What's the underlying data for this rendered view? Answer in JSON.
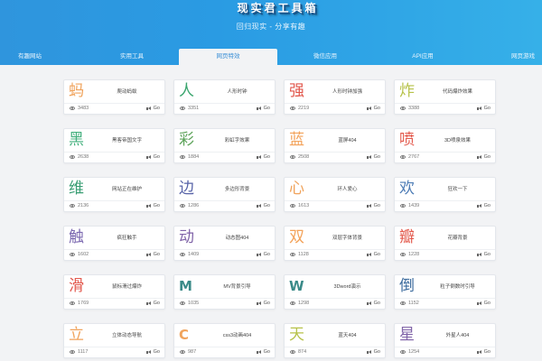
{
  "header": {
    "logo_chars": [
      "现",
      "实",
      "君",
      "工",
      "具",
      "箱"
    ],
    "subtitle": "回归现实 - 分享有趣",
    "accent_color": "#2f95dd"
  },
  "nav": {
    "tabs": [
      {
        "label": "有趣网站",
        "active": false
      },
      {
        "label": "实用工具",
        "active": false
      },
      {
        "label": "网页特效",
        "active": true
      },
      {
        "label": "微信应用",
        "active": false
      },
      {
        "label": "API应用",
        "active": false
      },
      {
        "label": "网页游戏",
        "active": false
      }
    ]
  },
  "cards": [
    {
      "char": "蚂",
      "color": "#f0a35c",
      "name": "爬动蚂蚁",
      "views": "3483",
      "go": "Go"
    },
    {
      "char": "人",
      "color": "#3aa56e",
      "name": "人形时钟",
      "views": "3351",
      "go": "Go"
    },
    {
      "char": "强",
      "color": "#e2574c",
      "name": "人形时钟加强",
      "views": "2219",
      "go": "Go"
    },
    {
      "char": "炸",
      "color": "#b7c24a",
      "name": "代码爆炸效果",
      "views": "3388",
      "go": "Go"
    },
    {
      "char": "黑",
      "color": "#45b07e",
      "name": "黑客帝国文字",
      "views": "2638",
      "go": "Go"
    },
    {
      "char": "彩",
      "color": "#5ea45b",
      "name": "彩虹字效果",
      "views": "1884",
      "go": "Go"
    },
    {
      "char": "蓝",
      "color": "#f3a35b",
      "name": "蓝屏404",
      "views": "2508",
      "go": "Go"
    },
    {
      "char": "喷",
      "color": "#e35a4d",
      "name": "3D喷泉效果",
      "views": "2767",
      "go": "Go"
    },
    {
      "char": "维",
      "color": "#3a9e74",
      "name": "网站正在维护",
      "views": "2136",
      "go": "Go"
    },
    {
      "char": "边",
      "color": "#5864a8",
      "name": "多边形背景",
      "views": "1286",
      "go": "Go"
    },
    {
      "char": "心",
      "color": "#f0a35c",
      "name": "环人爱心",
      "views": "1613",
      "go": "Go"
    },
    {
      "char": "欢",
      "color": "#4c7bb5",
      "name": "狂欢一下",
      "views": "1439",
      "go": "Go"
    },
    {
      "char": "触",
      "color": "#7b68b0",
      "name": "疯狂触手",
      "views": "1602",
      "go": "Go"
    },
    {
      "char": "动",
      "color": "#8064a8",
      "name": "动态图404",
      "views": "1409",
      "go": "Go"
    },
    {
      "char": "双",
      "color": "#f3a35b",
      "name": "双层字体背景",
      "views": "1128",
      "go": "Go"
    },
    {
      "char": "瓣",
      "color": "#e35a4d",
      "name": "花瓣背景",
      "views": "1228",
      "go": "Go"
    },
    {
      "char": "滑",
      "color": "#e2574c",
      "name": "鼠标滑过爆炸",
      "views": "1769",
      "go": "Go"
    },
    {
      "char": "M",
      "color": "#3a8a88",
      "name": "MV背景引导",
      "views": "1035",
      "go": "Go",
      "latin": true
    },
    {
      "char": "W",
      "color": "#3a8a88",
      "name": "3Dword演示",
      "views": "1298",
      "go": "Go",
      "latin": true
    },
    {
      "char": "倒",
      "color": "#3d6c9e",
      "name": "粒子倒数时引导",
      "views": "1152",
      "go": "Go"
    },
    {
      "char": "立",
      "color": "#f0a35c",
      "name": "立体动态导航",
      "views": "1117",
      "go": "Go"
    },
    {
      "char": "C",
      "color": "#f0a35c",
      "name": "css3动画404",
      "views": "987",
      "go": "Go",
      "latin": true
    },
    {
      "char": "天",
      "color": "#b7c24a",
      "name": "蓝天404",
      "views": "874",
      "go": "Go"
    },
    {
      "char": "星",
      "color": "#8064a8",
      "name": "外星人404",
      "views": "1254",
      "go": "Go"
    }
  ]
}
